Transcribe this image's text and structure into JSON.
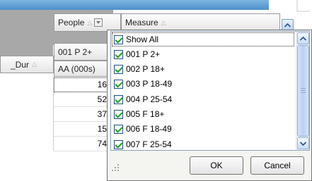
{
  "grid": {
    "headers": {
      "people": "People",
      "measure": "Measure",
      "dur": "_Dur",
      "p2": "001 P 2+",
      "aa": "AA (000s)"
    },
    "sort_glyph": "△",
    "values": [
      "16",
      "52",
      "37",
      "15",
      "74"
    ]
  },
  "popup": {
    "items": [
      {
        "label": "Show All",
        "checked": true
      },
      {
        "label": "001 P 2+",
        "checked": true
      },
      {
        "label": "002 P 18+",
        "checked": true
      },
      {
        "label": "003 P 18-49",
        "checked": true
      },
      {
        "label": "004 P 25-54",
        "checked": true
      },
      {
        "label": "005 F 18+",
        "checked": true
      },
      {
        "label": "006 F 18-49",
        "checked": true
      },
      {
        "label": "007 F 25-54",
        "checked": true
      }
    ],
    "ok_label": "OK",
    "cancel_label": "Cancel"
  },
  "colors": {
    "accent": "#4d8fcc",
    "check": "#21a121",
    "header_band": "#a8a8a8"
  }
}
